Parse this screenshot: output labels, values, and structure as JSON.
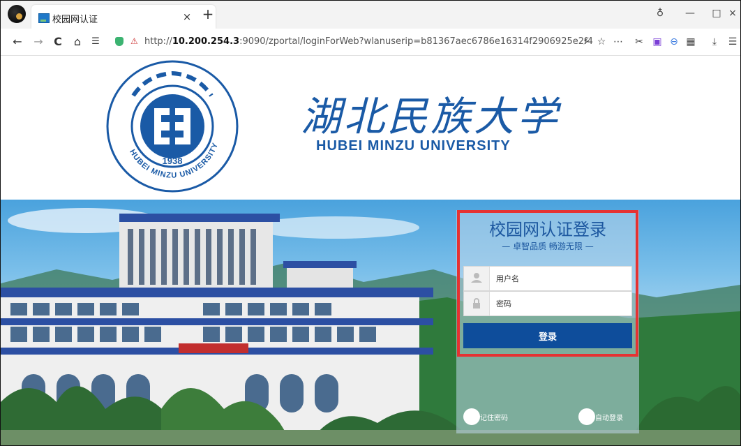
{
  "browser": {
    "tab_title": "校园网认证",
    "tab_close": "×",
    "new_tab": "+",
    "url_prefix": "http://",
    "url_host": "10.200.254.3",
    "url_rest": ":9090/zportal/loginForWeb?wlanuserip=b81367aec6786e16314f2906925e2f4",
    "nav": {
      "back": "←",
      "forward": "→",
      "reload": "C",
      "home": "⌂",
      "reading": "☰"
    },
    "window": {
      "minimize": "—",
      "maximize": "□",
      "close": "×",
      "tshirt": "♁"
    }
  },
  "header": {
    "name_cn": "湖北民族大学",
    "name_en": "HUBEI MINZU UNIVERSITY",
    "seal_year": "1938",
    "seal_text": "HUBEI MINZU UNIVERSITY"
  },
  "login": {
    "title": "校园网认证登录",
    "slogan": "— 卓智品质   畅游无限 —",
    "username_placeholder": "用户名",
    "password_placeholder": "密码",
    "submit_label": "登录",
    "remember_label": "记住密码",
    "auto_login_label": "自动登录"
  },
  "colors": {
    "brand": "#1a5aa6",
    "button": "#0e4d9b",
    "highlight": "#e53232"
  },
  "icons": [
    "user-icon",
    "lock-icon",
    "shield-icon",
    "star-icon",
    "menu-dots-icon"
  ]
}
